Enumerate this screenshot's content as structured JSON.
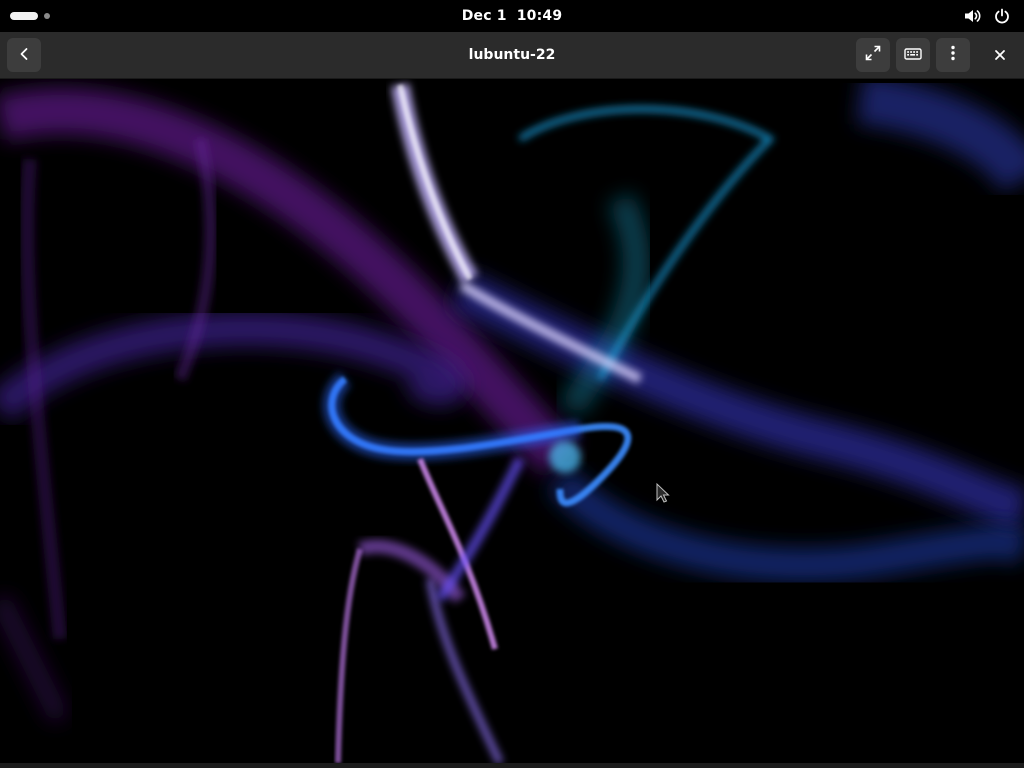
{
  "topbar": {
    "date": "Dec 1",
    "time": "10:49",
    "icons": [
      "volume-icon",
      "power-icon"
    ]
  },
  "window": {
    "title": "lubuntu-22",
    "buttons": [
      "back-icon",
      "fullscreen-icon",
      "keyboard-icon",
      "menu-dots-icon",
      "close-icon"
    ]
  },
  "colors": {
    "topbar_bg": "#000000",
    "headerbar_bg": "#2b2b2b",
    "button_bg": "#3d3d3d",
    "wallpaper_purple": "#8a2be2",
    "wallpaper_blue": "#1e64ff",
    "wallpaper_cyan": "#2fb7ff"
  }
}
